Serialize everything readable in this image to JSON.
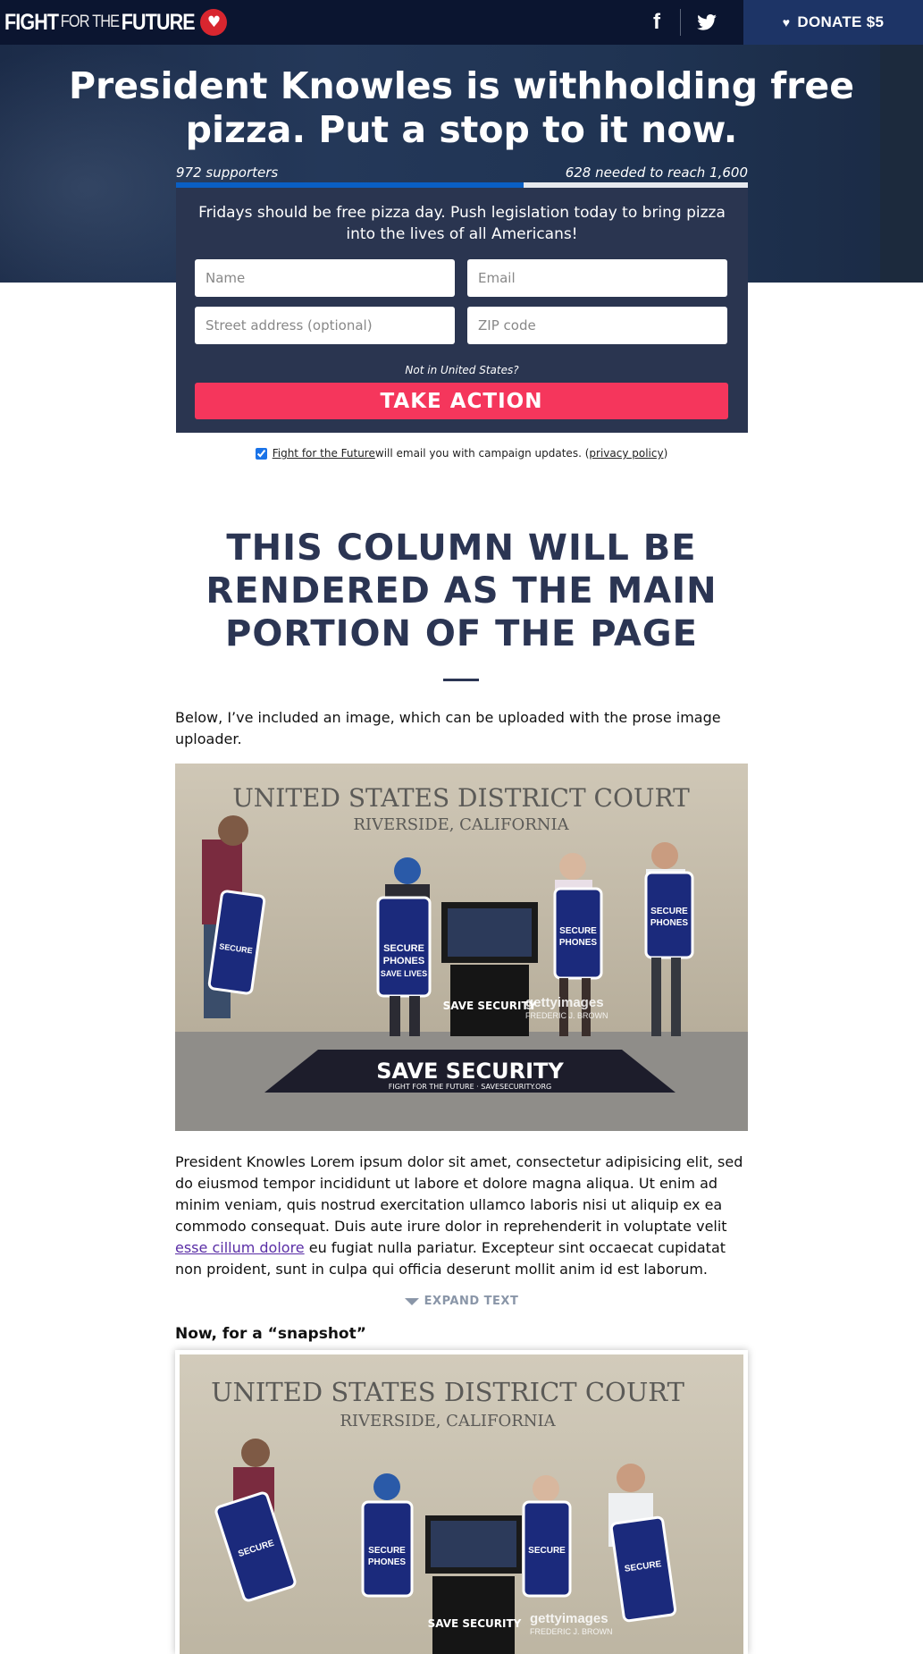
{
  "nav": {
    "logo": {
      "part1": "FIGHT",
      "part2": "FOR THE",
      "part3": "FUTURE"
    },
    "social": {
      "facebook": "f"
    },
    "donate_label": "DONATE $5"
  },
  "hero": {
    "title": "President Knowles is withholding free pizza. Put a stop to it now."
  },
  "progress": {
    "supporters_text": "972 supporters",
    "needed_text": "628 needed to reach 1,600",
    "supporters": 972,
    "goal": 1600,
    "color": "#0a5fc4"
  },
  "form": {
    "blurb": "Fridays should be free pizza day. Push legislation today to bring pizza into the lives of all Americans!",
    "name_placeholder": "Name",
    "email_placeholder": "Email",
    "address_placeholder": "Street address (optional)",
    "zip_placeholder": "ZIP code",
    "not_us": "Not in United States?",
    "submit_label": "TAKE ACTION",
    "submit_color": "#f5365c"
  },
  "optin": {
    "checked": true,
    "org_link": "Fight for the Future",
    "middle": " will email you with campaign updates. (",
    "privacy_link": "privacy policy",
    "end": ")"
  },
  "main": {
    "heading": "THIS COLUMN WILL BE RENDERED AS THE MAIN PORTION OF THE PAGE",
    "intro": "Below, I’ve included an image, which can be uploaded with the prose image uploader.",
    "body_before": "President Knowles Lorem ipsum dolor sit amet, consectetur adipisicing elit, sed do eiusmod tempor incididunt ut labore et dolore magna aliqua. Ut enim ad minim veniam, quis nostrud exercitation ullamco laboris nisi ut aliquip ex ea commodo consequat. Duis aute irure dolor in reprehenderit in voluptate velit ",
    "body_link": "esse cillum dolore",
    "body_after": " eu fugiat nulla pariatur. Excepteur sint occaecat cupidatat non proident, sunt in culpa qui officia deserunt mollit anim id est laborum.",
    "expand_label": "EXPAND TEXT",
    "snapshot_heading": "Now, for a “snapshot”"
  },
  "photo": {
    "court_line1": "UNITED STATES DISTRICT COURT",
    "court_line2": "RIVERSIDE, CALIFORNIA",
    "sign_line1": "SECURE",
    "sign_line2": "PHONES",
    "sign_line3": "SAVE LIVES",
    "mat_text": "SAVE SECURITY",
    "mat_footer": "FIGHT FOR THE FUTURE  ·  SAVESECURITY.ORG",
    "box_text": "SAVE SECURITY",
    "watermark": "gettyimages",
    "credit": "FREDERIC J. BROWN"
  }
}
